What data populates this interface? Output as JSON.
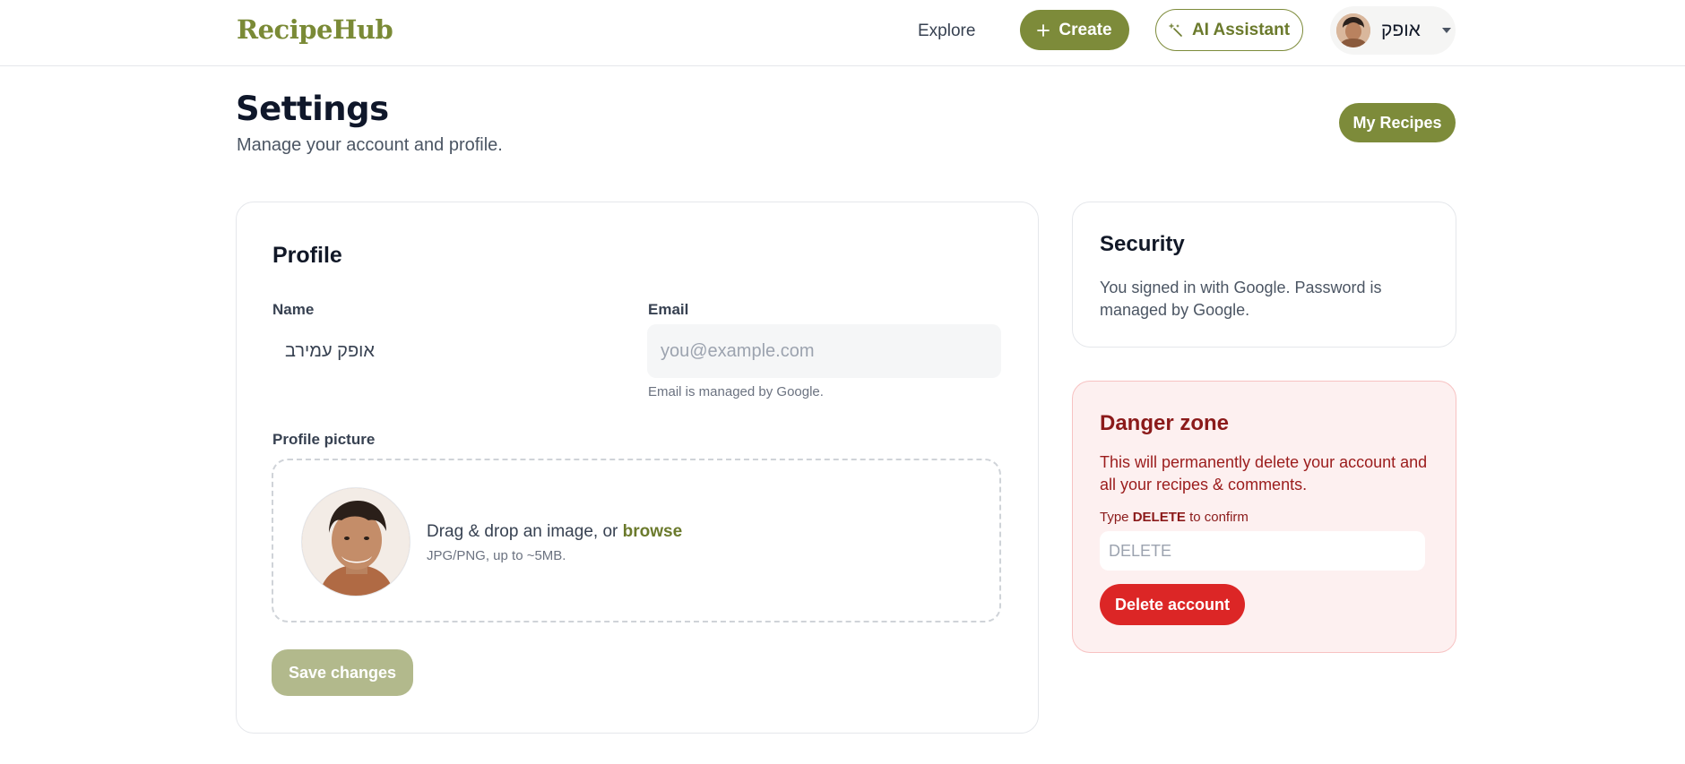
{
  "header": {
    "logo": "RecipeHub",
    "explore_label": "Explore",
    "create_label": "Create",
    "ai_label": "AI Assistant",
    "user_name": "אופק"
  },
  "page": {
    "title": "Settings",
    "subtitle": "Manage your account and profile.",
    "my_recipes_label": "My Recipes"
  },
  "profile": {
    "heading": "Profile",
    "name_label": "Name",
    "name_value": "אופק עמירב",
    "email_label": "Email",
    "email_placeholder": "you@example.com",
    "email_hint": "Email is managed by Google.",
    "picture_label": "Profile picture",
    "dropzone_text": "Drag & drop an image, or",
    "browse_label": "browse",
    "dropzone_hint": "JPG/PNG, up to ~5MB.",
    "save_label": "Save changes"
  },
  "security": {
    "heading": "Security",
    "text": "You signed in with Google. Password is managed by Google."
  },
  "danger": {
    "heading": "Danger zone",
    "text": "This will permanently delete your account and all your recipes & comments.",
    "confirm_prefix": "Type",
    "confirm_keyword": "DELETE",
    "confirm_suffix": "to confirm",
    "input_placeholder": "DELETE",
    "delete_label": "Delete account"
  },
  "icons": {
    "create": "plus-icon",
    "ai": "sparkle-wand-icon",
    "user_menu": "chevron-down-icon"
  },
  "colors": {
    "brand": "#7d8b3a",
    "danger": "#dc2626",
    "danger_bg": "#fdf0f0"
  }
}
